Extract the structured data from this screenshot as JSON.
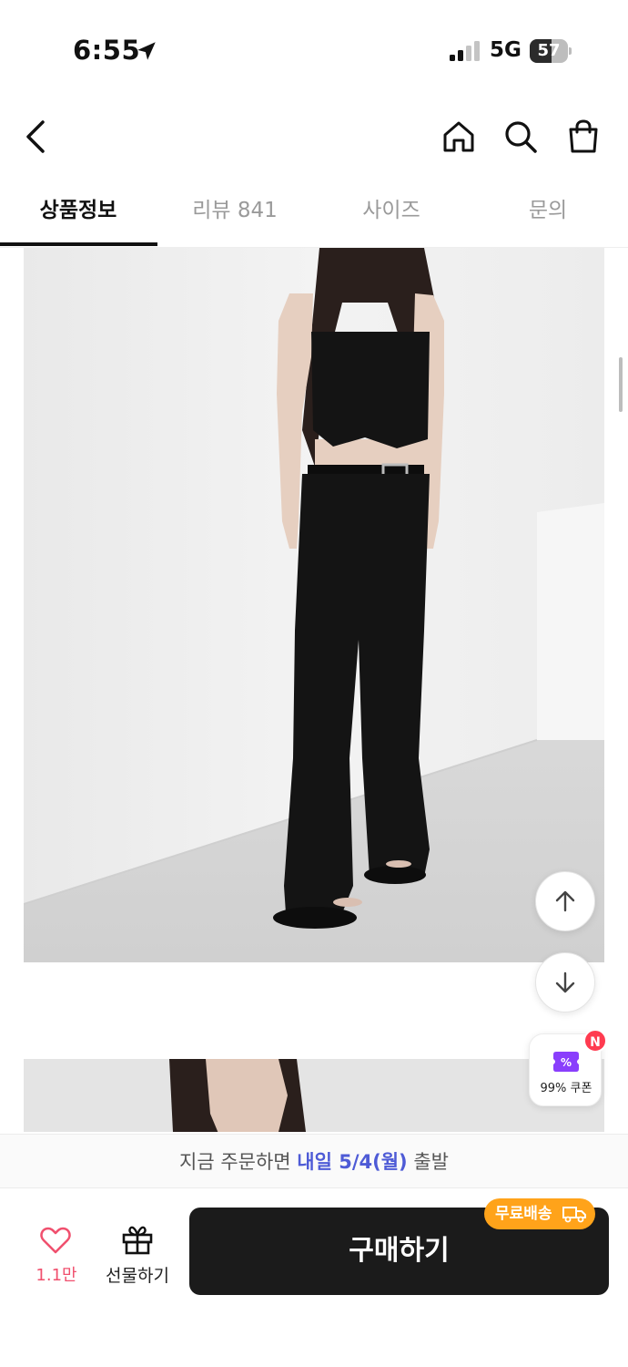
{
  "status_bar": {
    "time": "6:55",
    "network": "5G",
    "battery_level": "57",
    "battery_percent": 57
  },
  "header": {
    "back_icon": "chevron-left-icon",
    "home_icon": "home-icon",
    "search_icon": "search-icon",
    "cart_icon": "shopping-bag-icon"
  },
  "tabs": [
    {
      "label": "상품정보",
      "active": true
    },
    {
      "label": "리뷰 841",
      "active": false
    },
    {
      "label": "사이즈",
      "active": false
    },
    {
      "label": "문의",
      "active": false
    }
  ],
  "floating": {
    "scroll_up_icon": "arrow-up-icon",
    "scroll_down_icon": "arrow-down-icon",
    "coupon_label": "99% 쿠폰",
    "new_badge": "N"
  },
  "delivery": {
    "prefix": "지금 주문하면",
    "highlight": "내일 5/4(월)",
    "suffix": "출발"
  },
  "bottom_bar": {
    "like_count": "1.1만",
    "gift_label": "선물하기",
    "buy_label": "구매하기",
    "free_shipping_label": "무료배송"
  },
  "colors": {
    "accent_blue": "#4e5bd6",
    "like_pink": "#f0506e",
    "free_ship_orange": "#ffa31a",
    "coupon_purple": "#8a3ffc",
    "badge_red": "#ff3b50"
  }
}
